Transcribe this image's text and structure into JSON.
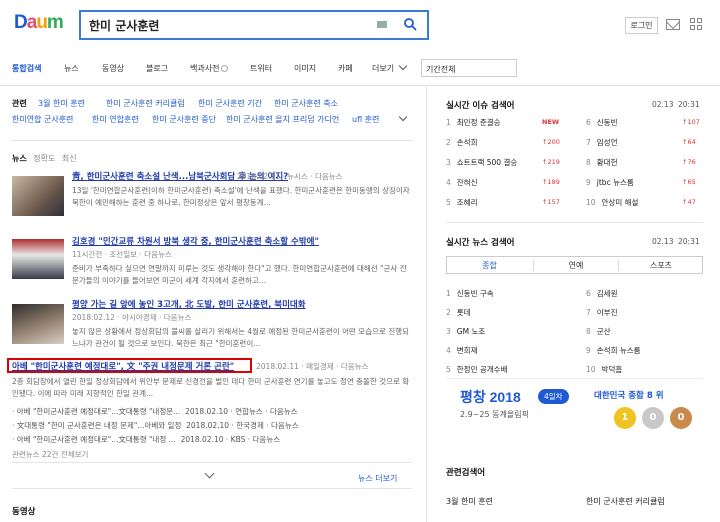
{
  "header": {
    "logo": "Daum",
    "query": "한미 군사훈련",
    "login": "로그인"
  },
  "tabs": [
    "통합검색",
    "뉴스",
    "동영상",
    "블로그",
    "백과사전",
    "트위터",
    "이미지",
    "카페",
    "더보기"
  ],
  "period": "기간전체",
  "related": {
    "label": "관련",
    "row1": [
      "3월 한미 훈련",
      "한미 군사훈련 커리큘럼",
      "한미 군사훈련 기간",
      "한미 군사훈련 축소"
    ],
    "row2": [
      "한미연합 군사훈련",
      "한미 연합훈련",
      "한미 군사훈련 중단",
      "한미 군사훈련 을지 프리덤 가디언",
      "ufl 훈련"
    ]
  },
  "news": {
    "title": "뉴스",
    "sort_accuracy": "정확도",
    "sort_latest": "최신",
    "more": "뉴스 더보기"
  },
  "articles": [
    {
      "title": "靑, 한미군사훈련 축소설 난색...남북군사회담 후 논의 여지?",
      "meta": [
        "2018.02.11",
        "뉴시스",
        "다음뉴스"
      ],
      "desc": "13일 '한미연합군사훈련(이하 한미군사훈련) 축소설'에 난색을 표했다. 한미군사훈련은 한미동맹의 상징이자 북한이 예민해하는 훈련 중 하나로, 한미정상은 앞서 평창동계..."
    },
    {
      "title": "김호경 \"민간교류 차원서 방북 생각 중, 한미군사훈련 축소할 수밖에\"",
      "meta": [
        "11시간전",
        "조선일보",
        "다음뉴스"
      ],
      "desc": "준비가 부족하다 싶으면 연말까지 미루는 것도 생각해야 한다\"고 했다. 한미연합군사훈련에 대해선 \"군사 전문가들의 이야기를 들어보면 미군이 세계 각지에서 훈련하고..."
    },
    {
      "title": "평양 가는 길 앞에 놓인 3고개, 北 도발, 한미 군사훈련, 북미대화",
      "meta": [
        "2018.02.12",
        "아시아경제",
        "다음뉴스"
      ],
      "desc": "놓지 않은 상황에서 정상회담의 불씨를 살리기 위해서는 4월로 예정된 한미군사훈련이 어떤 모습으로 진행되느냐가 관건이 될 것으로 보인다. 북한은 최근 \"한미훈련이..."
    },
    {
      "title": "아베 \"한미군사훈련 예정대로\", 文 \"주권 내정문제 거론 곤란\"",
      "meta": [
        "2018.02.11",
        "매일경제",
        "다음뉴스"
      ],
      "desc": "2층 회담장에서 열린 한일 정상회담에서 위안부 문제로 신경전을 벌인 데다 한미 군사훈련 연기를 놓고도 정면 충돌한 것으로 확인됐다. 이에 따라 미래 지향적인 한일 관계..."
    }
  ],
  "subnews": [
    {
      "title": "아베 \"한미군사훈련 예정대로\"...文대통령 \"내정문...",
      "date": "2018.02.10",
      "src": "연합뉴스",
      "via": "다음뉴스"
    },
    {
      "title": "文대통령 \"한미 군사훈련은 내정 문제\"...아베와 일정",
      "date": "2018.02.10",
      "src": "한국경제",
      "via": "다음뉴스"
    },
    {
      "title": "아베 \"한미군사훈련 예정대로\"...文대통령 \"내정 ...",
      "date": "2018.02.10",
      "src": "KBS",
      "via": "다음뉴스"
    }
  ],
  "related_news_more": "관련뉴스 22건 전체보기",
  "video_title": "동영상",
  "realtime": {
    "title": "실시간 이슈 검색어",
    "date": "02.13",
    "time": "20:31",
    "left": [
      [
        "1",
        "최민정 준결승",
        "NEW"
      ],
      [
        "2",
        "손석희",
        "200"
      ],
      [
        "3",
        "쇼트트랙 500 결승",
        "219"
      ],
      [
        "4",
        "잔혀신",
        "189"
      ],
      [
        "5",
        "조혜리",
        "157"
      ]
    ],
    "right": [
      [
        "6",
        "신동빈",
        "107"
      ],
      [
        "7",
        "임성언",
        "64"
      ],
      [
        "8",
        "황대헌",
        "76"
      ],
      [
        "9",
        "jtbc 뉴스룸",
        "65"
      ],
      [
        "10",
        "안상미 해설",
        "47"
      ]
    ]
  },
  "realtime_news": {
    "title": "실시간 뉴스 검색어",
    "date": "02.13",
    "time": "20:31",
    "sorts": [
      "종합",
      "연예",
      "스포츠"
    ],
    "left": [
      [
        "1",
        "신동빈 구속"
      ],
      [
        "2",
        "롯데"
      ],
      [
        "3",
        "GM 노조"
      ],
      [
        "4",
        "변희재"
      ],
      [
        "5",
        "한정민 공개수배"
      ]
    ],
    "right": [
      [
        "6",
        "김세원"
      ],
      [
        "7",
        "이부진"
      ],
      [
        "8",
        "군산"
      ],
      [
        "9",
        "손석희 뉴스룸"
      ],
      [
        "10",
        "박덕흠"
      ]
    ]
  },
  "banner": {
    "brand": "평창 2018",
    "days": "4일차",
    "dates": "2.9~25 동계올림픽",
    "rank": "대한민국 종합 8 위",
    "medals": [
      "1",
      "0",
      "0"
    ]
  },
  "related_search": {
    "title": "관련검색어",
    "items": [
      "3월 한미 훈련",
      "한미 군사훈련 커리큘럼"
    ]
  },
  "colors": {
    "accent": "#1f5ad3",
    "highlight": "#d00000",
    "up": "#d33333"
  }
}
